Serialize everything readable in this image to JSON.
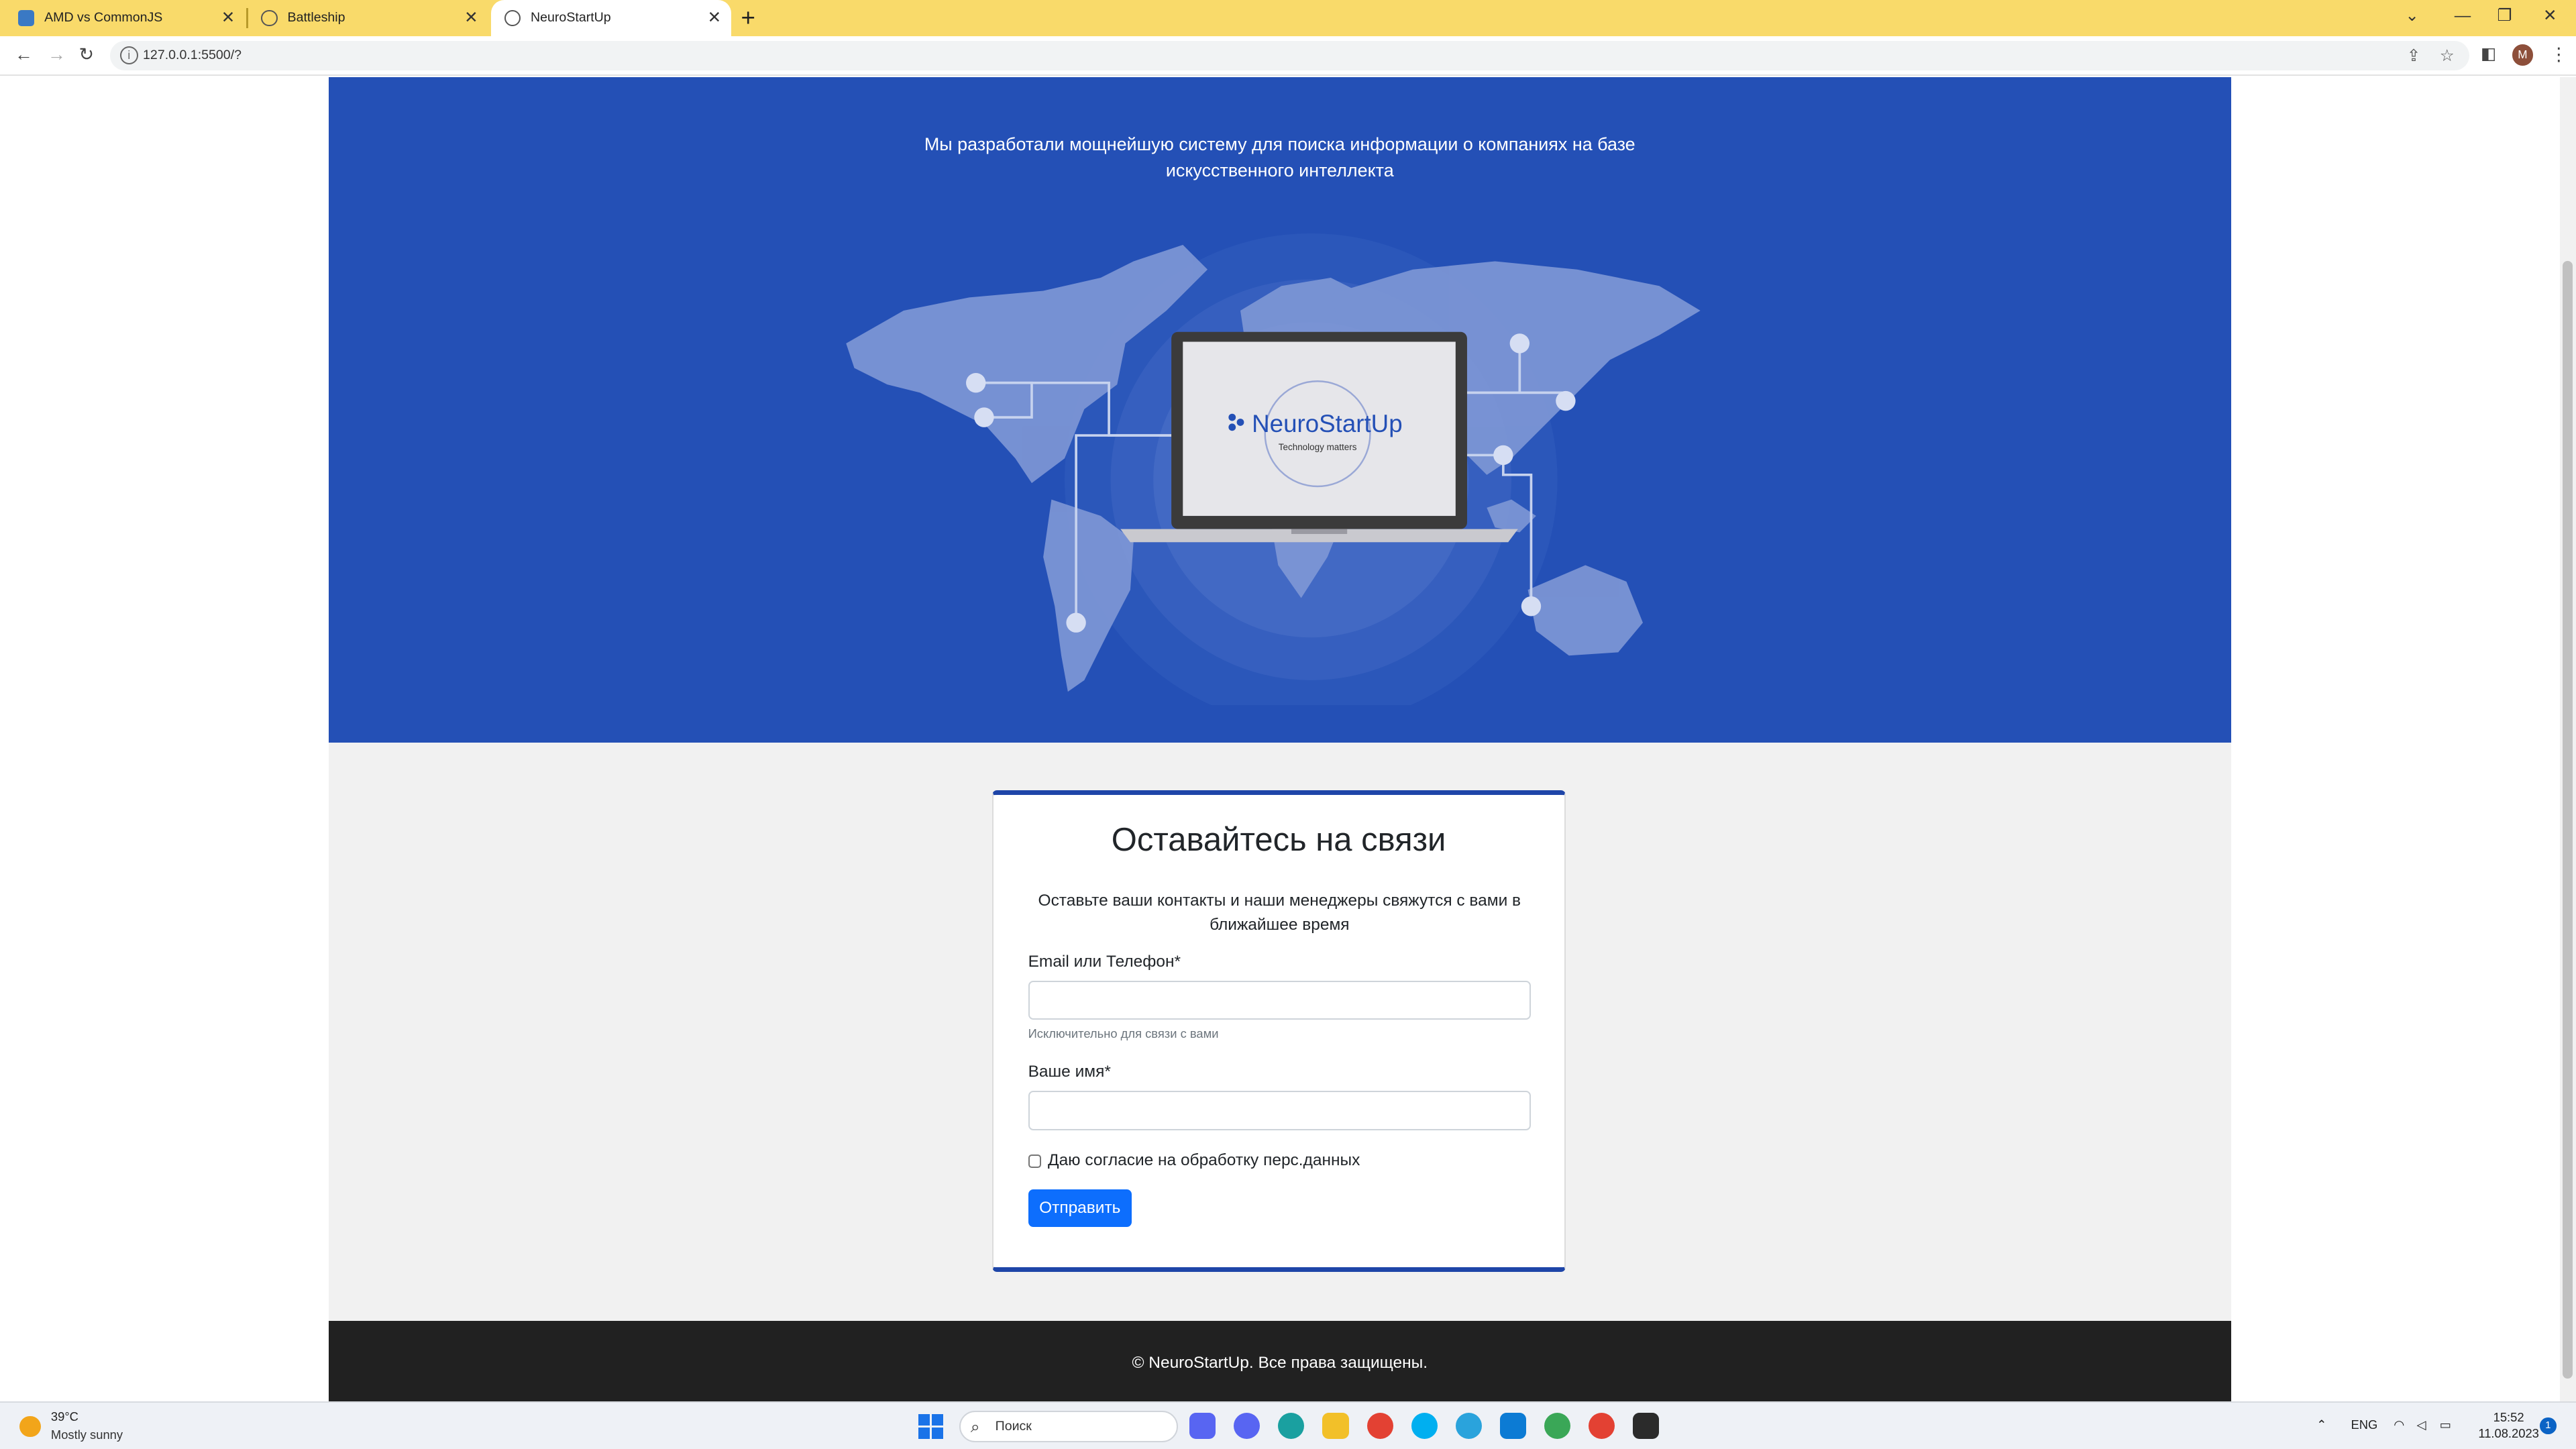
{
  "browser": {
    "tabs": [
      {
        "title": "AMD vs CommonJS",
        "fav_color": "#3a79c4"
      },
      {
        "title": "Battleship",
        "fav_color": "#6a6a6a"
      },
      {
        "title": "NeuroStartUp",
        "fav_color": "#6a6a6a",
        "active": true
      }
    ],
    "new_tab": "+",
    "url": "127.0.0.1:5500/?",
    "profile_initial": "M",
    "accent": "#f9da6a"
  },
  "page": {
    "hero_text": "Мы разработали мощнейшую систему для поиска информации о компаниях на базе искусственного интеллекта",
    "laptop_brand": "NeuroStartUp",
    "laptop_tagline": "Technology matters",
    "hero_color": "#2450b6",
    "contact": {
      "title": "Оставайтесь на связи",
      "lead": "Оставьте ваши контакты и наши менеджеры свяжутся с вами в ближайшее время",
      "email_label": "Email или Телефон*",
      "email_value": "",
      "email_help": "Исключительно для связи с вами",
      "name_label": "Ваше имя*",
      "name_value": "",
      "consent_label": "Даю согласие на обработку перс.данных",
      "consent_checked": false,
      "submit_label": "Отправить"
    },
    "footer_text": "© NeuroStartUp. Все права защищены."
  },
  "taskbar": {
    "weather_temp": "39°C",
    "weather_desc": "Mostly sunny",
    "search_placeholder": "Поиск",
    "lang": "ENG",
    "time": "15:52",
    "date": "11.08.2023",
    "notifications": "1",
    "apps": [
      "discord-like",
      "discord",
      "edge",
      "file-explorer",
      "chrome",
      "skype",
      "telegram",
      "vscode",
      "chrome-profile-1",
      "chrome-profile-2",
      "terminal"
    ]
  }
}
